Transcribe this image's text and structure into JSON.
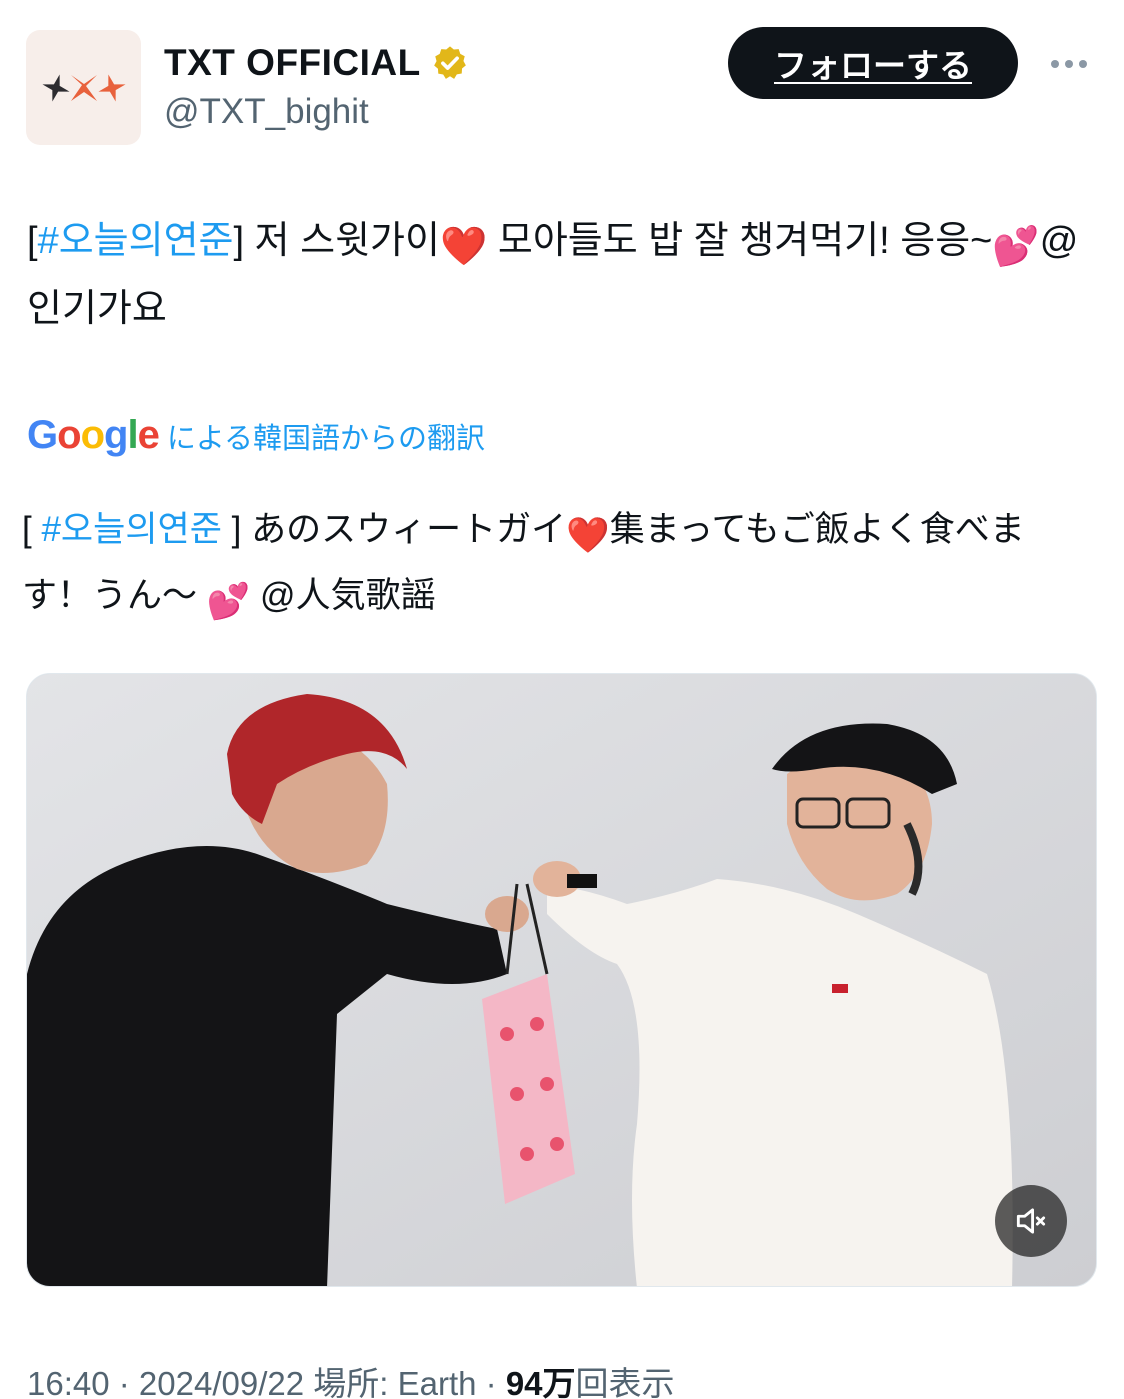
{
  "account": {
    "display_name": "TXT OFFICIAL",
    "handle": "@TXT_bighit",
    "verified_badge": "verified-gold-badge-icon",
    "avatar_icon": "txt-logo-icon"
  },
  "follow_button": {
    "label": "フォローする"
  },
  "more_button": {
    "icon": "more-dots-icon"
  },
  "tweet": {
    "bracket_open": "[",
    "hashtag": "#오늘의연준",
    "bracket_close": "]",
    "text_part1": " 저 스윗가이",
    "heart_emoji": "❤️",
    "text_part2": " 모아들도 밥 잘 챙겨먹기! 응응~",
    "sparkle_heart_emoji": "💕",
    "text_part3": "@ 인기가요"
  },
  "translation": {
    "google_letters": [
      "G",
      "o",
      "o",
      "g",
      "l",
      "e"
    ],
    "label": "による韓国語からの翻訳",
    "bracket_open": "[ ",
    "hashtag": "#오늘의연준",
    "bracket_close": " ]",
    "text_part1": " あのスウィートガイ",
    "heart_emoji": "❤️",
    "text_part2": "集まってもご飯よく食べます！うん〜 ",
    "sparkle_heart_emoji": "💕",
    "text_part3": " @人気歌謡"
  },
  "media": {
    "type": "video",
    "mute_icon": "volume-muted-icon"
  },
  "meta": {
    "time": "16:40",
    "sep1": " · ",
    "date": "2024/09/22",
    "location": " 場所: Earth",
    "sep2": " · ",
    "views_count": "94万",
    "views_label": "回表示"
  },
  "colors": {
    "link": "#1d9bf0",
    "text_primary": "#0f1419",
    "text_secondary": "#536471",
    "follow_bg": "#0f1419",
    "verified_gold": "#e2b719"
  }
}
